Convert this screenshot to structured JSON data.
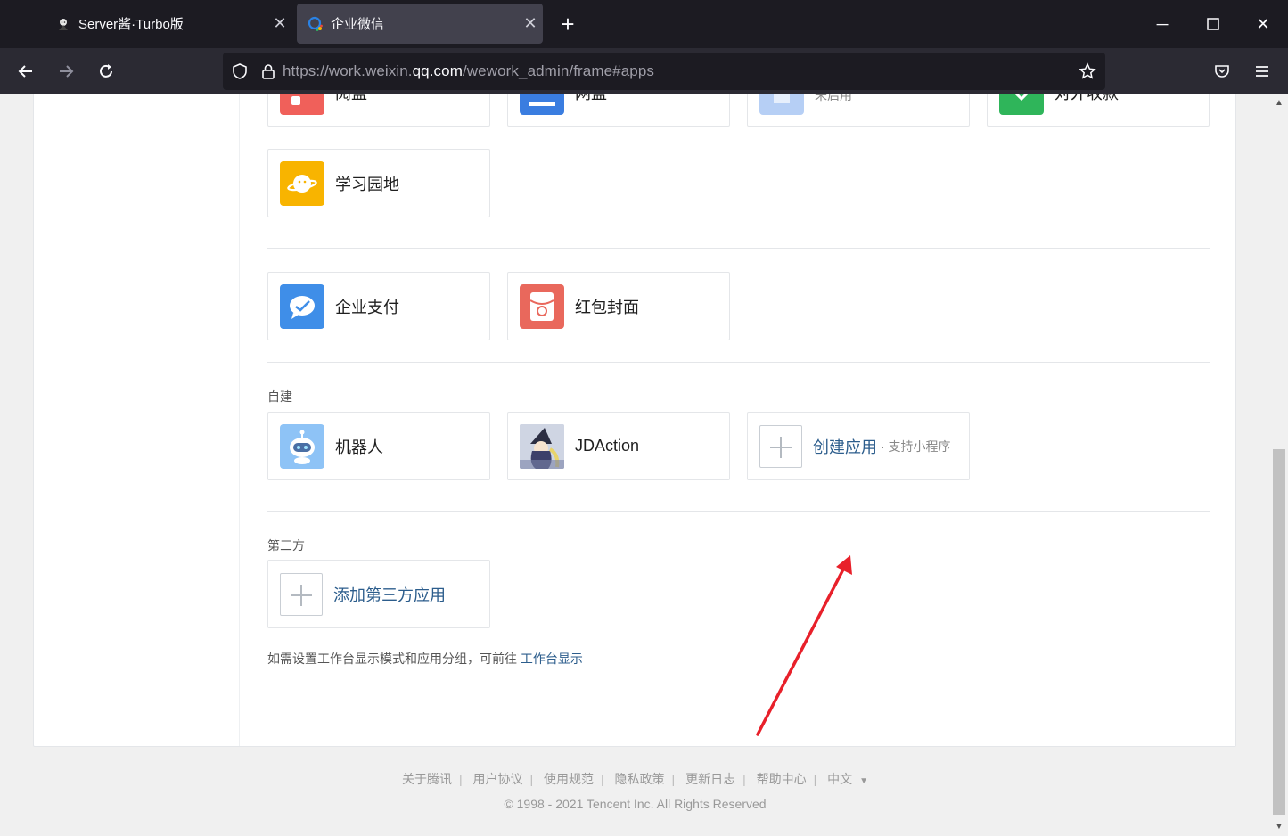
{
  "browser": {
    "tabs": [
      {
        "title": "Server酱·Turbo版",
        "active": false
      },
      {
        "title": "企业微信",
        "active": true
      }
    ],
    "url": {
      "prefix": "https://work.weixin.",
      "domain": "qq.com",
      "path": "/wework_admin/frame#apps"
    }
  },
  "apps": {
    "top_row": [
      {
        "name": "阅盘",
        "icon_color": "#f0605a"
      },
      {
        "name": "网盘",
        "icon_color": "#3a7de0"
      },
      {
        "name": "",
        "status": "未启用",
        "icon_color": "#b6cff5"
      },
      {
        "name": "对外收款",
        "icon_color": "#2fb55a"
      }
    ],
    "learning": {
      "name": "学习园地",
      "icon_color": "#f8b400"
    },
    "payments": [
      {
        "name": "企业支付",
        "icon_color": "#3f8ee8"
      },
      {
        "name": "红包封面",
        "icon_color": "#e9685c"
      }
    ],
    "custom": {
      "label": "自建",
      "items": [
        {
          "name": "机器人",
          "icon_color": "#8ec3f6"
        },
        {
          "name": "JDAction"
        }
      ],
      "create": {
        "label": "创建应用",
        "hint": "· 支持小程序"
      }
    },
    "third_party": {
      "label": "第三方",
      "add_label": "添加第三方应用"
    },
    "note": {
      "text": "如需设置工作台显示模式和应用分组，可前往 ",
      "link": "工作台显示"
    }
  },
  "footer": {
    "links": [
      "关于腾讯",
      "用户协议",
      "使用规范",
      "隐私政策",
      "更新日志",
      "帮助中心",
      "中文"
    ],
    "copyright": "© 1998 - 2021 Tencent Inc. All Rights Reserved"
  },
  "colors": {
    "annotation_arrow": "#e8202a",
    "link": "#2c5d8c"
  }
}
